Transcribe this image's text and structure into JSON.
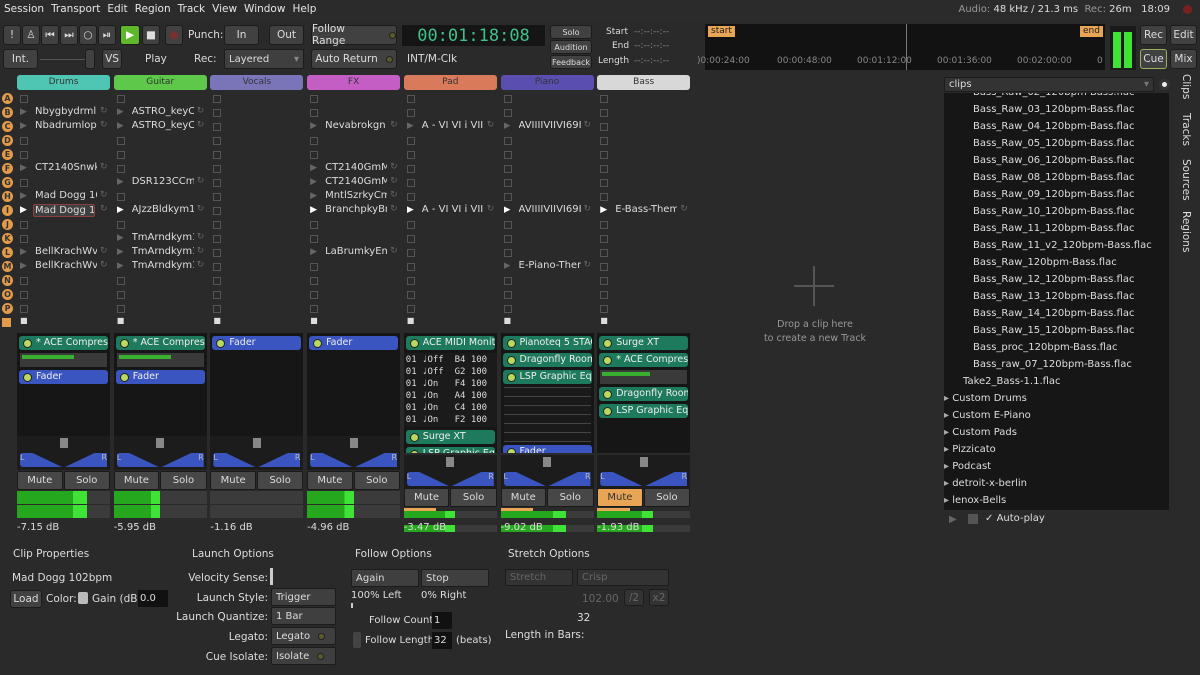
{
  "menu": [
    "Session",
    "Transport",
    "Edit",
    "Region",
    "Track",
    "View",
    "Window",
    "Help"
  ],
  "status": {
    "audio_label": "Audio:",
    "audio": "48 kHz / 21.3 ms",
    "rec_label": "Rec:",
    "rec": "26m",
    "time": "18:09"
  },
  "transport": {
    "punch_label": "Punch:",
    "in": "In",
    "out": "Out",
    "follow_range": "Follow Range",
    "auto_return": "Auto Return",
    "int": "Int.",
    "vs": "VS",
    "play": "Play",
    "rec_label": "Rec:",
    "rec_mode": "Layered",
    "clock": "00:01:18:08",
    "sync": "INT/M-Clk",
    "solo": "Solo",
    "audition": "Audition",
    "feedback": "Feedback"
  },
  "range": {
    "start_label": "Start",
    "end_label": "End",
    "length_label": "Length",
    "start": "--:--:--:--",
    "end": "--:--:--:--",
    "length": "--:--:--:--"
  },
  "timeline": {
    "start_marker": "start",
    "end_marker": "end",
    "ticks": [
      ")0:00:24:00",
      "00:00:48:00",
      "00:01:12:00",
      "00:01:36:00",
      "00:02:00:00",
      "0"
    ]
  },
  "pages": {
    "rec": "Rec",
    "edit": "Edit",
    "cue": "Cue",
    "mix": "Mix",
    "active": "Cue"
  },
  "rows": [
    "A",
    "B",
    "C",
    "D",
    "E",
    "F",
    "G",
    "H",
    "I",
    "J",
    "K",
    "L",
    "M",
    "N",
    "O",
    "P"
  ],
  "strips": [
    {
      "name": "Drums",
      "color": "#4fc6b4",
      "playing": 8,
      "selected": 8,
      "clips": [
        "",
        "Nbygbydrmlp",
        "Nbadrumlop",
        "",
        "",
        "CT2140Snwk",
        "",
        "Mad Dogg 102bpm",
        "Mad Dogg 102bpm",
        "",
        "",
        "BellKrachWv",
        "BellKrachWv",
        "",
        "",
        ""
      ],
      "procs": [
        {
          "name": "* ACE Compressor",
          "type": "plugin",
          "meter": 0.6
        },
        {
          "name": "Fader",
          "type": "fader"
        }
      ],
      "mute": false,
      "db": "-7.15 dB",
      "level": 0.75
    },
    {
      "name": "Guitar",
      "color": "#5ec84a",
      "playing": 8,
      "clips": [
        "",
        "ASTRO_keyC",
        "ASTRO_keyC",
        "",
        "",
        "",
        "DSR123CCm",
        "",
        "AJzzBldkym1",
        "",
        "TmArndkym1",
        "TmArndkym1",
        "TmArndkym1",
        "",
        "",
        ""
      ],
      "procs": [
        {
          "name": "* ACE Compressor",
          "type": "plugin",
          "meter": 0.6
        },
        {
          "name": "Fader",
          "type": "fader"
        }
      ],
      "mute": false,
      "db": "-5.95 dB",
      "level": 0.5
    },
    {
      "name": "Vocals",
      "color": "#7a74b8",
      "clips": [
        "",
        "",
        "",
        "",
        "",
        "",
        "",
        "",
        "",
        "",
        "",
        "",
        "",
        "",
        "",
        ""
      ],
      "procs": [
        {
          "name": "Fader",
          "type": "fader"
        }
      ],
      "mute": false,
      "db": "-1.16 dB",
      "level": 0
    },
    {
      "name": "FX",
      "color": "#c45ec4",
      "playing": 8,
      "clips": [
        "",
        "",
        "Nevabrokgn",
        "",
        "",
        "CT2140GmM",
        "CT2140GmM",
        "MntlSzrkyCm",
        "BranchpkyBr",
        "",
        "",
        "LaBrumkyEm",
        "",
        "",
        "",
        ""
      ],
      "procs": [
        {
          "name": "Fader",
          "type": "fader"
        }
      ],
      "mute": false,
      "db": "-4.96 dB",
      "level": 0.5
    },
    {
      "name": "Pad",
      "color": "#d97a5a",
      "playing": 8,
      "clips": [
        "",
        "",
        "A - VI VI i VII",
        "",
        "",
        "",
        "",
        "",
        "A - VI VI i VII",
        "",
        "",
        "",
        "",
        "",
        "",
        ""
      ],
      "procs": [
        {
          "name": "ACE MIDI Monitor",
          "type": "plugin",
          "midi": [
            "01 ♩Off  B4 100",
            "01 ♩Off  G2 100",
            "01 ♩On   F4 100",
            "01 ♩On   A4 100",
            "01 ♩On   C4 100",
            "01 ♩On   F2 100"
          ]
        },
        {
          "name": "Surge XT",
          "type": "plugin"
        },
        {
          "name": "LSP Graphic Equalizer",
          "type": "plugin"
        }
      ],
      "mute": false,
      "db": "-3.47 dB",
      "level": 0.55
    },
    {
      "name": "Piano",
      "color": "#5a4fb0",
      "playing": 8,
      "clips": [
        "",
        "",
        "AVIIIIVIIVI69I",
        "",
        "",
        "",
        "",
        "",
        "AVIIIIVIIVI69I",
        "",
        "",
        "",
        "E-Piano-Them",
        "",
        "",
        ""
      ],
      "procs": [
        {
          "name": "Pianoteq 5 STAGE",
          "type": "plugin"
        },
        {
          "name": "Dragonfly Room",
          "type": "plugin"
        },
        {
          "name": "LSP Graphic Equalizer",
          "type": "plugin",
          "eq": true
        },
        {
          "name": "Fader",
          "type": "fader"
        }
      ],
      "mute": false,
      "db": "-9.02 dB",
      "level": 0.7
    },
    {
      "name": "Bass",
      "color": "#d8d8d8",
      "playing": 8,
      "clips": [
        "",
        "",
        "",
        "",
        "",
        "",
        "",
        "",
        "E-Bass-Them",
        "",
        "",
        "",
        "",
        "",
        "",
        ""
      ],
      "procs": [
        {
          "name": "Surge XT",
          "type": "plugin"
        },
        {
          "name": "* ACE Compressor",
          "type": "plugin",
          "meter": 0.55
        },
        {
          "name": "Dragonfly Room",
          "type": "plugin"
        },
        {
          "name": "LSP Graphic Equalizer",
          "type": "plugin"
        }
      ],
      "mute": true,
      "db": "-1.93 dB",
      "level": 0.6
    }
  ],
  "mute_label": "Mute",
  "solo_label": "Solo",
  "drop": {
    "line1": "Drop a clip here",
    "line2": "to create a new Track"
  },
  "sidebar": {
    "dropdown": "clips",
    "files": [
      "Bass_Raw_02_120bpm-Bass.flac",
      "Bass_Raw_03_120bpm-Bass.flac",
      "Bass_Raw_04_120bpm-Bass.flac",
      "Bass_Raw_05_120bpm-Bass.flac",
      "Bass_Raw_06_120bpm-Bass.flac",
      "Bass_Raw_08_120bpm-Bass.flac",
      "Bass_Raw_09_120bpm-Bass.flac",
      "Bass_Raw_10_120bpm-Bass.flac",
      "Bass_Raw_11_120bpm-Bass.flac",
      "Bass_Raw_11_v2_120bpm-Bass.flac",
      "Bass_Raw_120bpm-Bass.flac",
      "Bass_Raw_12_120bpm-Bass.flac",
      "Bass_Raw_13_120bpm-Bass.flac",
      "Bass_Raw_14_120bpm-Bass.flac",
      "Bass_Raw_15_120bpm-Bass.flac",
      "Bass_proc_120bpm-Bass.flac",
      "Bass_raw_07_120bpm-Bass.flac"
    ],
    "take": "Take2_Bass-1.1.flac",
    "folders": [
      "Custom Drums",
      "Custom E-Piano",
      "Custom Pads",
      "Pizzicato",
      "Podcast",
      "detroit-x-berlin",
      "lenox-Bells"
    ],
    "autoplay": "Auto-play",
    "tabs": [
      "Clips",
      "Tracks",
      "Sources",
      "Regions"
    ]
  },
  "clip_props": {
    "title": "Clip Properties",
    "name": "Mad Dogg 102bpm",
    "load": "Load",
    "color_label": "Color:",
    "gain_label": "Gain (dB):",
    "gain": "0.0"
  },
  "launch": {
    "title": "Launch Options",
    "velocity_label": "Velocity Sense:",
    "style_label": "Launch Style:",
    "style": "Trigger",
    "quant_label": "Launch Quantize:",
    "quant": "1 Bar",
    "legato_label": "Legato:",
    "legato": "Legato",
    "isolate_label": "Cue Isolate:",
    "isolate": "Isolate"
  },
  "follow": {
    "title": "Follow Options",
    "left": "Again",
    "right": "Stop",
    "left_pct": "100% Left",
    "right_pct": "0% Right",
    "count_label": "Follow Count:",
    "count": "1",
    "length_label": "Follow Length:",
    "length": "32",
    "unit": "(beats)"
  },
  "stretch": {
    "title": "Stretch Options",
    "stretch": "Stretch",
    "mode": "Crisp",
    "bpm": "102.00",
    "half": "/2",
    "double": "x2",
    "bars": "32",
    "bars_label": "Length in Bars:"
  }
}
